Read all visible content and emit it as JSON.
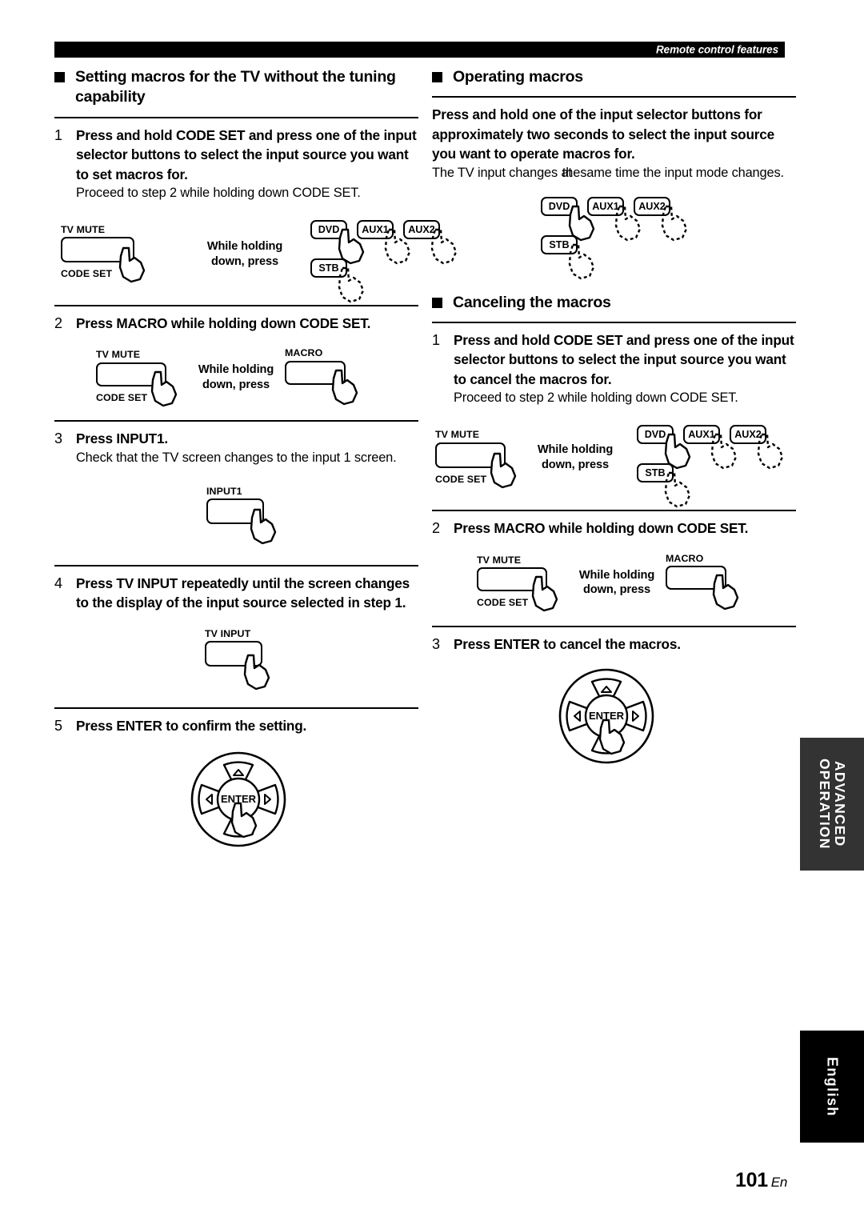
{
  "header": {
    "running_title": "Remote control features"
  },
  "left_column": {
    "section": {
      "title": "Setting macros for the TV without the tuning capability"
    },
    "steps": [
      {
        "number": "1",
        "title": "Press and hold CODE SET and press one of the input selector buttons to select the input source you want to set macros for.",
        "desc": "Proceed to step 2 while holding down CODE SET.",
        "figure": {
          "type": "codeset-to-inputs",
          "left_button": {
            "label_top": "TV MUTE",
            "label_bottom": "CODE SET"
          },
          "connector": "While holding\ndown, press",
          "buttons": [
            {
              "label": "DVD",
              "hand": "solid"
            },
            {
              "label": "AUX1",
              "hand": "dashed"
            },
            {
              "label": "AUX2",
              "hand": "dashed"
            },
            {
              "label": "STB",
              "hand": "dashed"
            }
          ]
        }
      },
      {
        "number": "2",
        "title": "Press MACRO while holding down CODE SET.",
        "desc": "",
        "figure": {
          "type": "codeset-to-macro",
          "left_button": {
            "label_top": "TV MUTE",
            "label_bottom": "CODE SET"
          },
          "connector": "While holding\ndown, press",
          "right_button": {
            "label_top": "MACRO"
          }
        }
      },
      {
        "number": "3",
        "title": "Press INPUT1.",
        "desc": "Check that the TV screen changes to the input 1 screen.",
        "figure": {
          "type": "single-button",
          "button": {
            "label_top": "INPUT1"
          }
        }
      },
      {
        "number": "4",
        "title": "Press TV INPUT repeatedly until the screen changes to the display of the input source selected in step 1.",
        "desc": "",
        "figure": {
          "type": "single-button",
          "button": {
            "label_top": "TV INPUT"
          }
        }
      },
      {
        "number": "5",
        "title": "Press ENTER to confirm the setting.",
        "desc": "",
        "figure": {
          "type": "enter-pad",
          "center_label": "ENTER"
        }
      }
    ]
  },
  "right_column": {
    "section_operating": {
      "title": "Operating macros",
      "body_bold": "Press and hold one of the input selector buttons for approximately two seconds to select the input source you want to operate macros for.",
      "body_normal_part1": "The TV input changes at",
      "body_normal_overlap": "the",
      "body_normal_part2": "same time the input mode changes.",
      "figure": {
        "type": "input-buttons",
        "buttons": [
          {
            "label": "DVD",
            "hand": "solid"
          },
          {
            "label": "AUX1",
            "hand": "dashed"
          },
          {
            "label": "AUX2",
            "hand": "dashed"
          },
          {
            "label": "STB",
            "hand": "dashed"
          }
        ]
      }
    },
    "section_canceling": {
      "title": "Canceling the macros",
      "steps": [
        {
          "number": "1",
          "title": "Press and hold CODE SET and press one of the input selector buttons to select the input source you want to cancel the macros for.",
          "desc": "Proceed to step 2 while holding down CODE SET.",
          "figure": {
            "type": "codeset-to-inputs",
            "left_button": {
              "label_top": "TV MUTE",
              "label_bottom": "CODE SET"
            },
            "connector": "While holding\ndown, press",
            "buttons": [
              {
                "label": "DVD",
                "hand": "solid"
              },
              {
                "label": "AUX1",
                "hand": "dashed"
              },
              {
                "label": "AUX2",
                "hand": "dashed"
              },
              {
                "label": "STB",
                "hand": "dashed"
              }
            ]
          }
        },
        {
          "number": "2",
          "title": "Press MACRO while holding down CODE SET.",
          "desc": "",
          "figure": {
            "type": "codeset-to-macro",
            "left_button": {
              "label_top": "TV MUTE",
              "label_bottom": "CODE SET"
            },
            "connector": "While holding\ndown, press",
            "right_button": {
              "label_top": "MACRO"
            }
          }
        },
        {
          "number": "3",
          "title": "Press ENTER to cancel the macros.",
          "desc": "",
          "figure": {
            "type": "enter-pad",
            "center_label": "ENTER"
          }
        }
      ]
    }
  },
  "side_tabs": {
    "advanced": "ADVANCED\nOPERATION",
    "language": "English"
  },
  "footer": {
    "page_number": "101",
    "page_suffix": "En"
  },
  "colors": {
    "ink": "#000000",
    "tab_advanced_bg": "#333333",
    "tab_language_bg": "#000000",
    "paper": "#ffffff"
  }
}
